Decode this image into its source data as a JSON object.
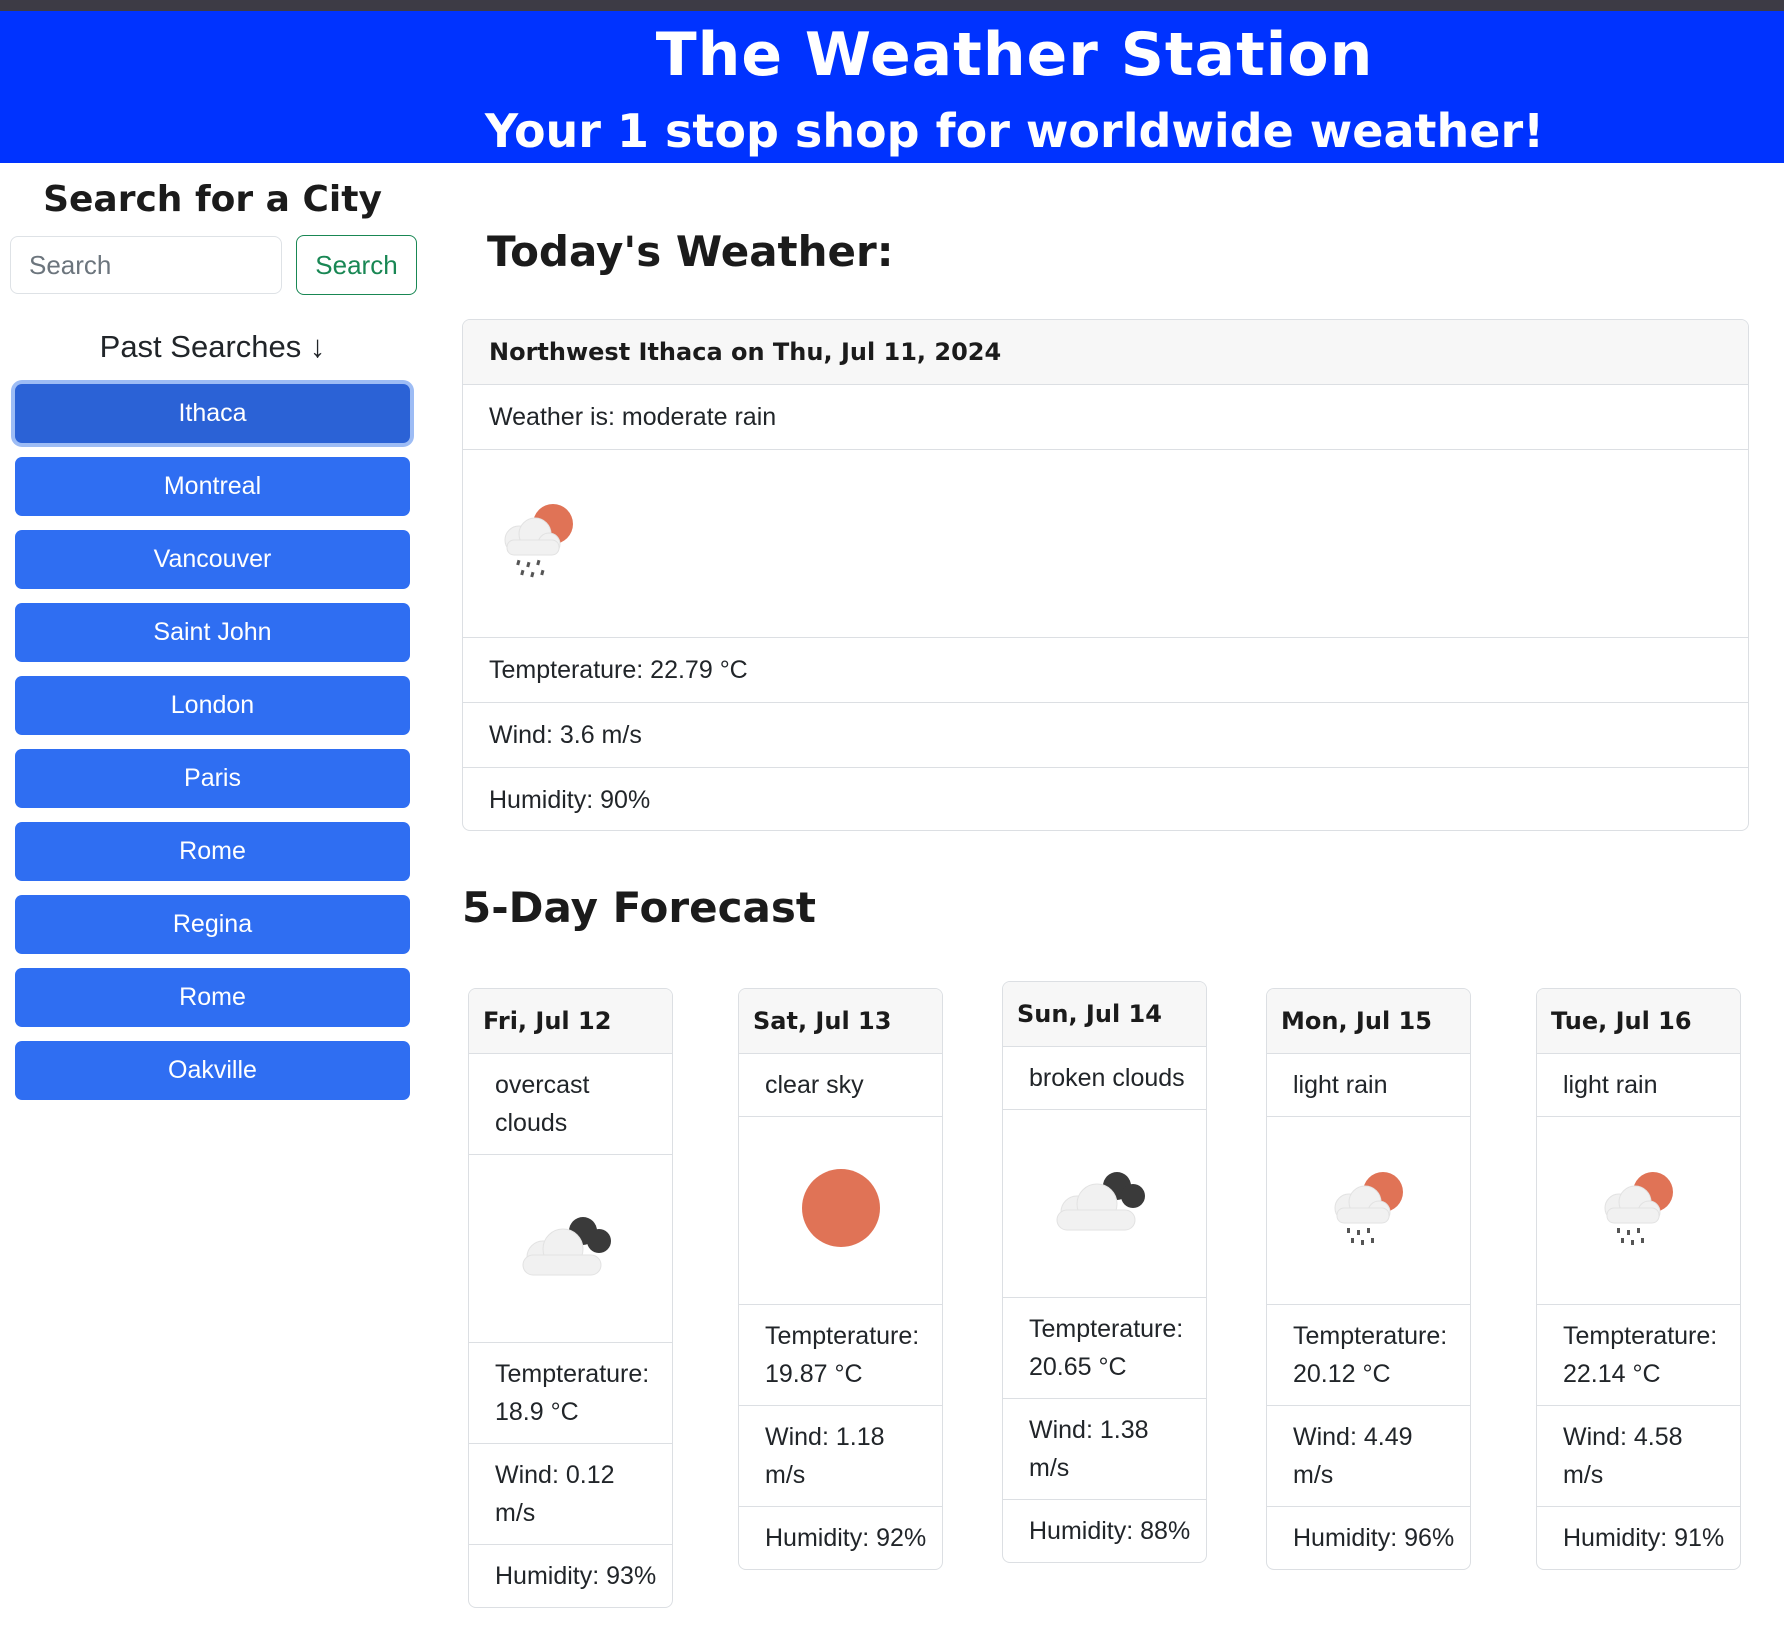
{
  "header": {
    "title": "The Weather Station",
    "subtitle": "Your 1 stop shop for worldwide weather!"
  },
  "sidebar": {
    "title": "Search for a City",
    "search_placeholder": "Search",
    "search_button": "Search",
    "past_title": "Past Searches ↓",
    "past_searches": [
      "Ithaca",
      "Montreal",
      "Vancouver",
      "Saint John",
      "London",
      "Paris",
      "Rome",
      "Regina",
      "Rome",
      "Oakville"
    ]
  },
  "today": {
    "heading": "Today's Weather:",
    "location_date": "Northwest Ithaca on Thu, Jul 11, 2024",
    "weather": "Weather is: moderate rain",
    "icon": "rain-sun-icon",
    "temperature": "Tempterature: 22.79 °C",
    "wind": "Wind: 3.6 m/s",
    "humidity": "Humidity: 90%"
  },
  "forecast": {
    "heading": "5-Day Forecast",
    "days": [
      {
        "date": "Fri, Jul 12",
        "desc": "overcast clouds",
        "icon": "clouds-icon",
        "temp": "Tempterature: 18.9 °C",
        "wind": "Wind: 0.12 m/s",
        "humidity": "Humidity: 93%"
      },
      {
        "date": "Sat, Jul 13",
        "desc": "clear sky",
        "icon": "sun-icon",
        "temp": "Tempterature: 19.87 °C",
        "wind": "Wind: 1.18 m/s",
        "humidity": "Humidity: 92%"
      },
      {
        "date": "Sun, Jul 14",
        "desc": "broken clouds",
        "icon": "clouds-icon",
        "temp": "Tempterature: 20.65 °C",
        "wind": "Wind: 1.38 m/s",
        "humidity": "Humidity: 88%"
      },
      {
        "date": "Mon, Jul 15",
        "desc": "light rain",
        "icon": "rain-sun-icon",
        "temp": "Tempterature: 20.12 °C",
        "wind": "Wind: 4.49 m/s",
        "humidity": "Humidity: 96%"
      },
      {
        "date": "Tue, Jul 16",
        "desc": "light rain",
        "icon": "rain-sun-icon",
        "temp": "Tempterature: 22.14 °C",
        "wind": "Wind: 4.58 m/s",
        "humidity": "Humidity: 91%"
      }
    ]
  },
  "colors": {
    "banner": "#0033ff",
    "city_button": "#2f6ef2",
    "search_button": "#198754",
    "sun": "#e07356"
  }
}
